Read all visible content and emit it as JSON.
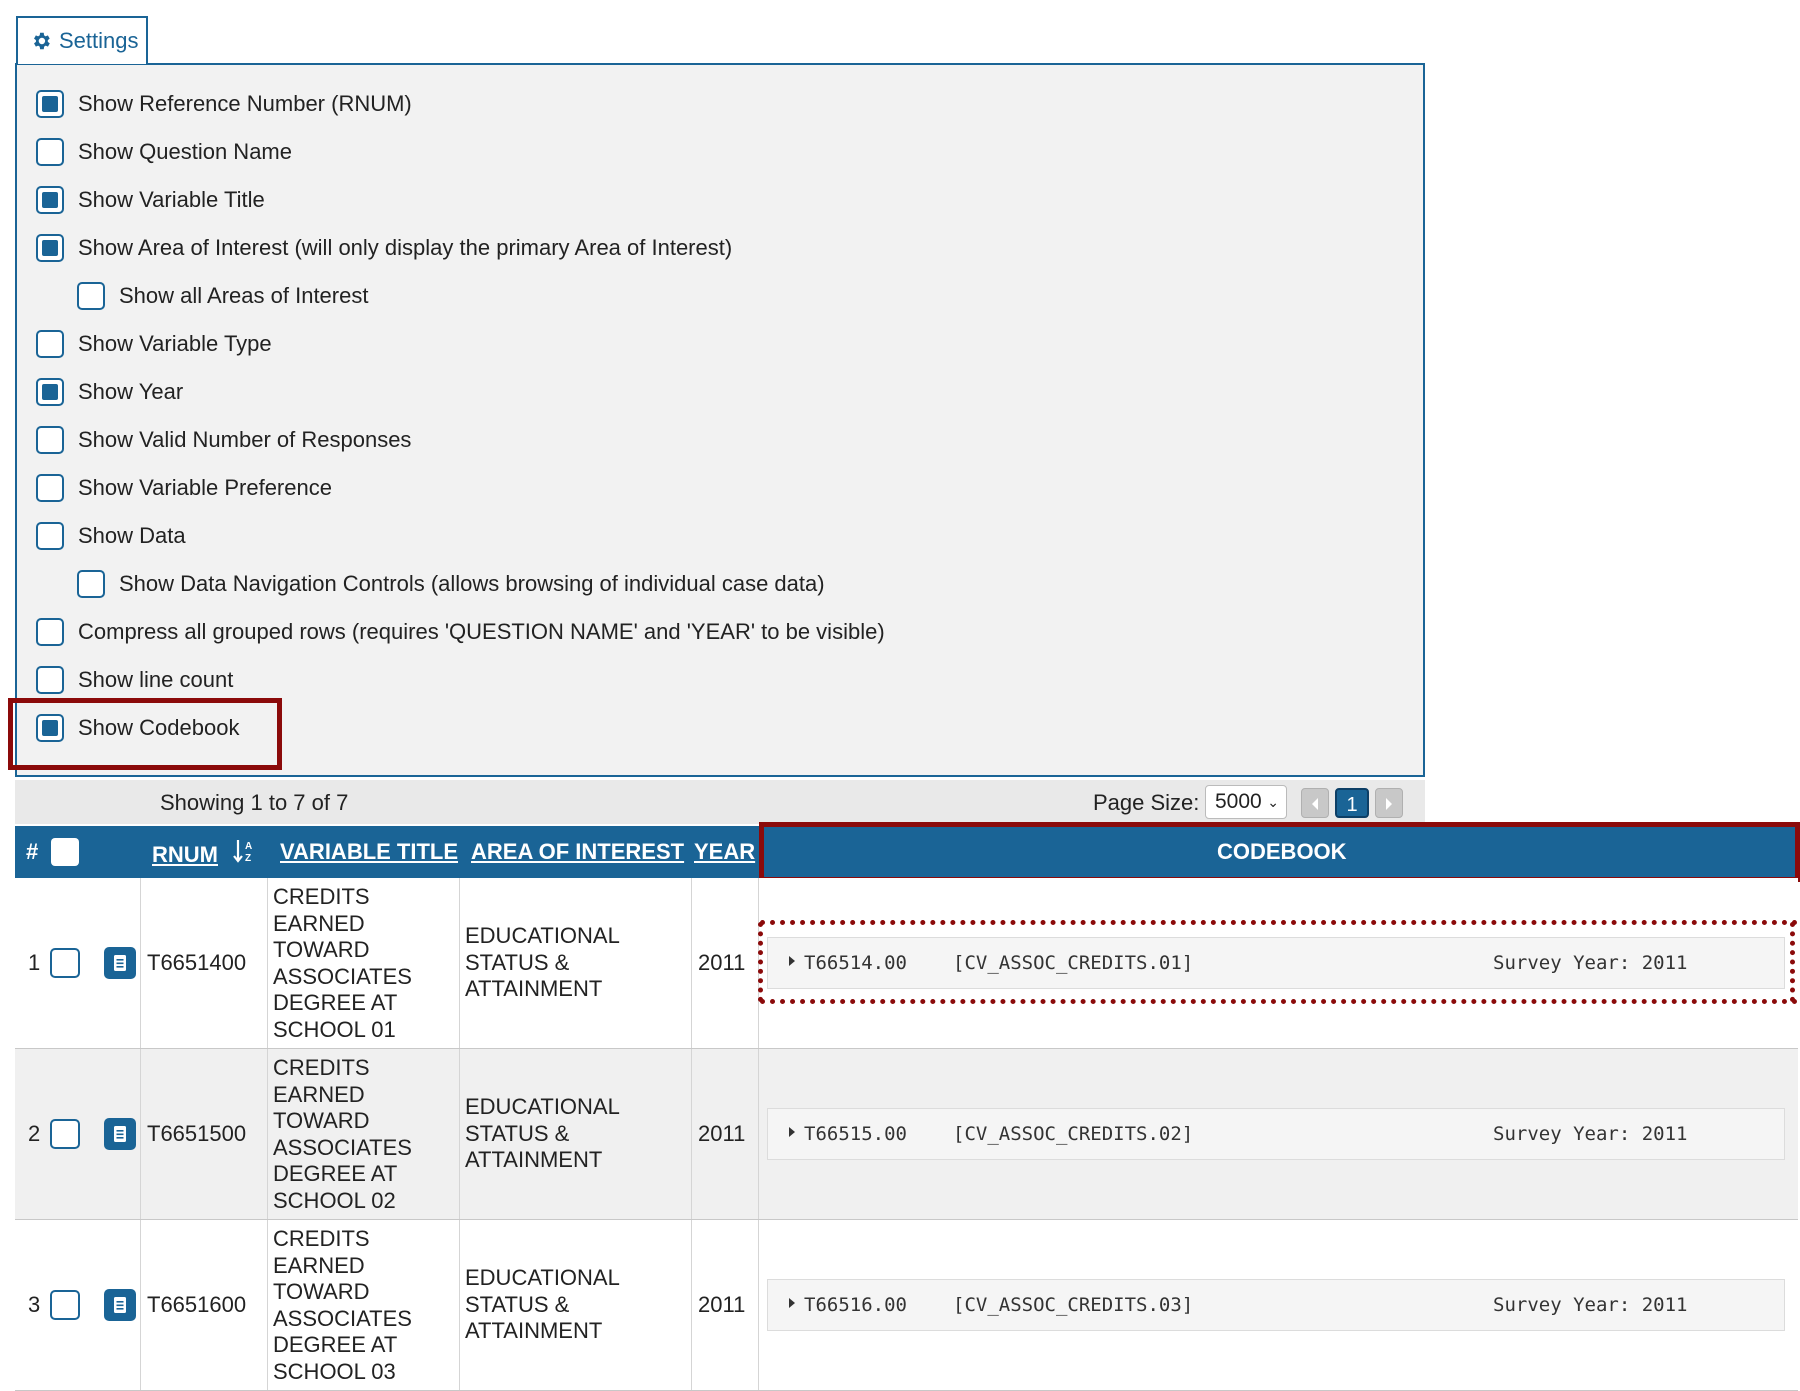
{
  "settings": {
    "tab_label": "Settings",
    "options": [
      {
        "label": "Show Reference Number (RNUM)",
        "checked": true,
        "indent": false
      },
      {
        "label": "Show Question Name",
        "checked": false,
        "indent": false
      },
      {
        "label": "Show Variable Title",
        "checked": true,
        "indent": false
      },
      {
        "label": "Show Area of Interest (will only display the primary Area of Interest)",
        "checked": true,
        "indent": false
      },
      {
        "label": "Show all Areas of Interest",
        "checked": false,
        "indent": true
      },
      {
        "label": "Show Variable Type",
        "checked": false,
        "indent": false
      },
      {
        "label": "Show Year",
        "checked": true,
        "indent": false
      },
      {
        "label": "Show Valid Number of Responses",
        "checked": false,
        "indent": false
      },
      {
        "label": "Show Variable Preference",
        "checked": false,
        "indent": false
      },
      {
        "label": "Show Data",
        "checked": false,
        "indent": false
      },
      {
        "label": "Show Data Navigation Controls (allows browsing of individual case data)",
        "checked": false,
        "indent": true
      },
      {
        "label": "Compress all grouped rows (requires 'QUESTION NAME' and 'YEAR' to be visible)",
        "checked": false,
        "indent": false
      },
      {
        "label": "Show line count",
        "checked": false,
        "indent": false
      },
      {
        "label": "Show Codebook",
        "checked": true,
        "indent": false
      }
    ]
  },
  "summary": {
    "showing": "Showing 1 to 7 of 7",
    "page_size_label": "Page Size:",
    "page_size_value": "5000",
    "current_page": "1"
  },
  "table": {
    "headers": {
      "index": "#",
      "rnum": "RNUM",
      "variable_title": "VARIABLE TITLE",
      "area_of_interest": "AREA OF INTEREST",
      "year": "YEAR",
      "codebook": "CODEBOOK"
    },
    "rows": [
      {
        "index": "1",
        "rnum": "T6651400",
        "title_lines": [
          "CREDITS",
          "EARNED",
          "TOWARD",
          "ASSOCIATES",
          "DEGREE AT",
          "SCHOOL 01"
        ],
        "aoi_lines": [
          "EDUCATIONAL",
          "STATUS &",
          "ATTAINMENT"
        ],
        "year": "2011",
        "codebook_ref": "T66514.00",
        "codebook_var": "[CV_ASSOC_CREDITS.01]",
        "codebook_year": "Survey Year: 2011"
      },
      {
        "index": "2",
        "rnum": "T6651500",
        "title_lines": [
          "CREDITS",
          "EARNED",
          "TOWARD",
          "ASSOCIATES",
          "DEGREE AT",
          "SCHOOL 02"
        ],
        "aoi_lines": [
          "EDUCATIONAL",
          "STATUS &",
          "ATTAINMENT"
        ],
        "year": "2011",
        "codebook_ref": "T66515.00",
        "codebook_var": "[CV_ASSOC_CREDITS.02]",
        "codebook_year": "Survey Year: 2011"
      },
      {
        "index": "3",
        "rnum": "T6651600",
        "title_lines": [
          "CREDITS",
          "EARNED",
          "TOWARD",
          "ASSOCIATES",
          "DEGREE AT",
          "SCHOOL 03"
        ],
        "aoi_lines": [
          "EDUCATIONAL",
          "STATUS &",
          "ATTAINMENT"
        ],
        "year": "2011",
        "codebook_ref": "T66516.00",
        "codebook_var": "[CV_ASSOC_CREDITS.03]",
        "codebook_year": "Survey Year: 2011"
      }
    ]
  },
  "colors": {
    "accent": "#1a6496",
    "highlight": "#8b0a0a",
    "panel_bg": "#f2f2f2"
  }
}
